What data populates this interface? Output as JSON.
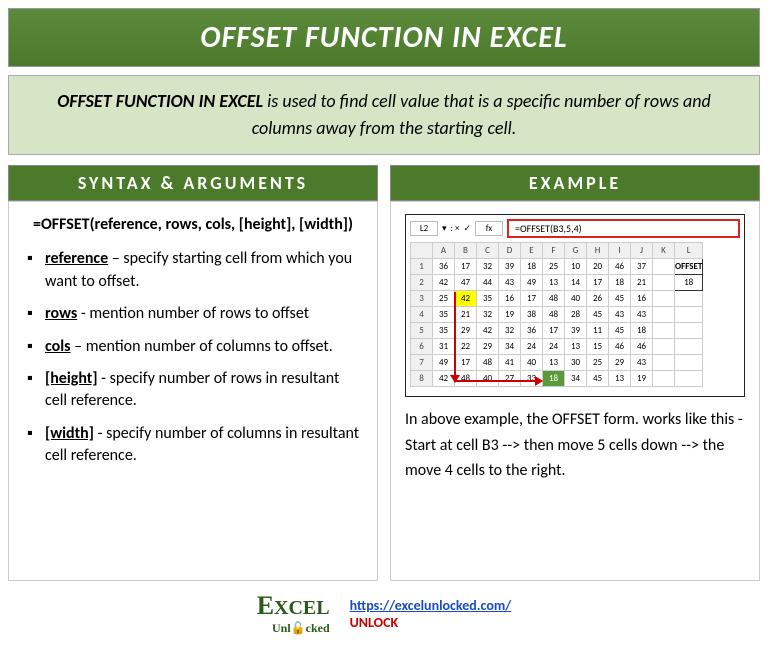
{
  "title": "OFFSET FUNCTION IN EXCEL",
  "intro": {
    "bold": "OFFSET FUNCTION IN EXCEL",
    "rest": " is used to find cell value that is a specific number of rows and columns away from the starting cell."
  },
  "syntax": {
    "header": "SYNTAX & ARGUMENTS",
    "formula": "=OFFSET(reference, rows, cols, [height], [width])",
    "args": [
      {
        "name": "reference",
        "desc": " – specify starting cell from which you want to offset."
      },
      {
        "name": "rows",
        "desc": " - mention number of rows to offset"
      },
      {
        "name": "cols",
        "desc": " – mention number of columns to offset."
      },
      {
        "name": "[height]",
        "desc": " - specify number of rows in resultant cell reference."
      },
      {
        "name": "[width]",
        "desc": " - specify number of columns in resultant cell reference."
      }
    ]
  },
  "example": {
    "header": "EXAMPLE",
    "cell_ref": "L2",
    "fx": "fx",
    "formula": "=OFFSET(B3,5,4)",
    "offset_label": "OFFSET",
    "offset_value": "18",
    "cols": [
      "A",
      "B",
      "C",
      "D",
      "E",
      "F",
      "G",
      "H",
      "I",
      "J",
      "K",
      "L"
    ],
    "rows": [
      [
        "36",
        "17",
        "32",
        "39",
        "18",
        "25",
        "10",
        "20",
        "46",
        "37"
      ],
      [
        "42",
        "47",
        "44",
        "43",
        "49",
        "13",
        "14",
        "17",
        "18",
        "21"
      ],
      [
        "25",
        "42",
        "35",
        "16",
        "17",
        "48",
        "40",
        "26",
        "45",
        "16"
      ],
      [
        "35",
        "21",
        "32",
        "19",
        "38",
        "48",
        "28",
        "45",
        "43",
        "43"
      ],
      [
        "35",
        "29",
        "42",
        "32",
        "36",
        "17",
        "39",
        "11",
        "45",
        "18"
      ],
      [
        "31",
        "22",
        "29",
        "34",
        "24",
        "24",
        "13",
        "15",
        "46",
        "46"
      ],
      [
        "49",
        "17",
        "48",
        "41",
        "40",
        "13",
        "30",
        "25",
        "29",
        "43"
      ],
      [
        "42",
        "48",
        "40",
        "27",
        "33",
        "18",
        "34",
        "45",
        "13",
        "19"
      ]
    ],
    "explain": "In above example, the OFFSET form. works like this - Start at cell B3 --> then move 5 cells down --> the move 4 cells to the right."
  },
  "footer": {
    "logo1": "E",
    "logo2": "XCEL",
    "logo_sub": "Unl🔓cked",
    "url": "https://excelunlocked.com/",
    "unlock": "UNLOCK"
  }
}
